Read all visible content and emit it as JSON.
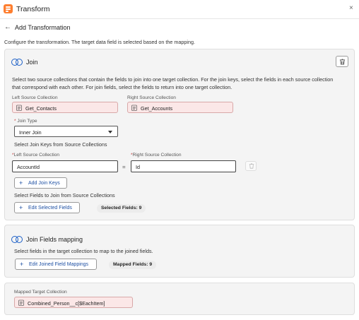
{
  "header": {
    "title": "Transform",
    "close_icon": "×"
  },
  "page": {
    "back_icon": "←",
    "title": "Add Transformation",
    "description": "Configure the transformation. The target data field is selected based on the mapping."
  },
  "join": {
    "title": "Join",
    "description_line1": "Select two source collections that contain the fields to join into one target collection. For the join keys, select the fields in each source collection",
    "description_line2": "that correspond with each other. For join fields, select the fields to return into one target collection.",
    "left_source_label": "Left Source Collection",
    "left_source_value": "Get_Contacts",
    "right_source_label": "Right Source Collection",
    "right_source_value": "Get_Accounts",
    "join_type_label": "Join Type",
    "join_type_value": "Inner Join",
    "join_keys_heading": "Select Join Keys from Source Collections",
    "key_left_label": "Left Source Collection",
    "key_left_value": "AccountId",
    "equals": "=",
    "key_right_label": "Right Source Collection",
    "key_right_value": "Id",
    "add_join_keys_label": "Add Join Keys",
    "select_fields_heading": "Select Fields to Join from Source Collections",
    "edit_selected_fields_label": "Edit Selected Fields",
    "selected_fields_badge": "Selected Fields: 9",
    "required_mark": "*",
    "plus_icon": "+"
  },
  "join_mapping": {
    "title": "Join Fields mapping",
    "description": "Select fields in the target collection to map to the joined fields.",
    "edit_mappings_label": "Edit Joined Field Mappings",
    "mapped_fields_badge": "Mapped Fields: 9"
  },
  "target": {
    "label": "Mapped Target Collection",
    "value": "Combined_Person__c[$EachItem]"
  },
  "colors": {
    "accent": "#1b5fc7",
    "brand": "#fe7e2f",
    "error_bg": "#fbe7e7"
  }
}
